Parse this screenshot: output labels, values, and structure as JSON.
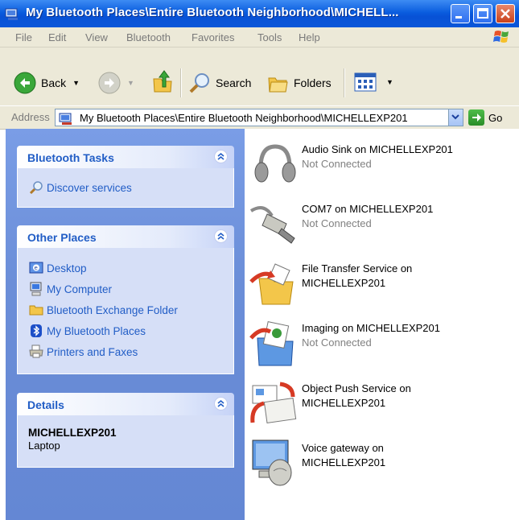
{
  "window": {
    "title": "My Bluetooth Places\\Entire Bluetooth Neighborhood\\MICHELL..."
  },
  "menu": [
    "File",
    "Edit",
    "View",
    "Bluetooth",
    "Favorites",
    "Tools",
    "Help"
  ],
  "toolbar": {
    "back_label": "Back",
    "search_label": "Search",
    "folders_label": "Folders"
  },
  "address": {
    "label": "Address",
    "value": "My Bluetooth Places\\Entire Bluetooth Neighborhood\\MICHELLEXP201",
    "go_label": "Go"
  },
  "panels": {
    "tasks": {
      "title": "Bluetooth Tasks",
      "items": [
        {
          "label": "Discover services",
          "icon": "search-icon"
        }
      ]
    },
    "places": {
      "title": "Other Places",
      "items": [
        {
          "label": "Desktop",
          "icon": "desktop-icon"
        },
        {
          "label": "My Computer",
          "icon": "computer-icon"
        },
        {
          "label": "Bluetooth Exchange Folder",
          "icon": "folder-icon"
        },
        {
          "label": "My Bluetooth Places",
          "icon": "bluetooth-icon"
        },
        {
          "label": "Printers and Faxes",
          "icon": "printer-icon"
        }
      ]
    },
    "details": {
      "title": "Details",
      "name": "MICHELLEXP201",
      "type": "Laptop"
    }
  },
  "services": [
    {
      "name": "Audio Sink on MICHELLEXP201",
      "status": "Not Connected",
      "icon": "headphones-icon"
    },
    {
      "name": "COM7 on MICHELLEXP201",
      "status": "Not Connected",
      "icon": "serial-cable-icon"
    },
    {
      "name": "File Transfer Service on MICHELLEXP201",
      "status": "",
      "icon": "file-transfer-icon"
    },
    {
      "name": "Imaging on MICHELLEXP201",
      "status": "Not Connected",
      "icon": "imaging-icon"
    },
    {
      "name": "Object Push Service on MICHELLEXP201",
      "status": "",
      "icon": "object-push-icon"
    },
    {
      "name": "Voice gateway on MICHELLEXP201",
      "status": "",
      "icon": "voice-gateway-icon"
    }
  ]
}
